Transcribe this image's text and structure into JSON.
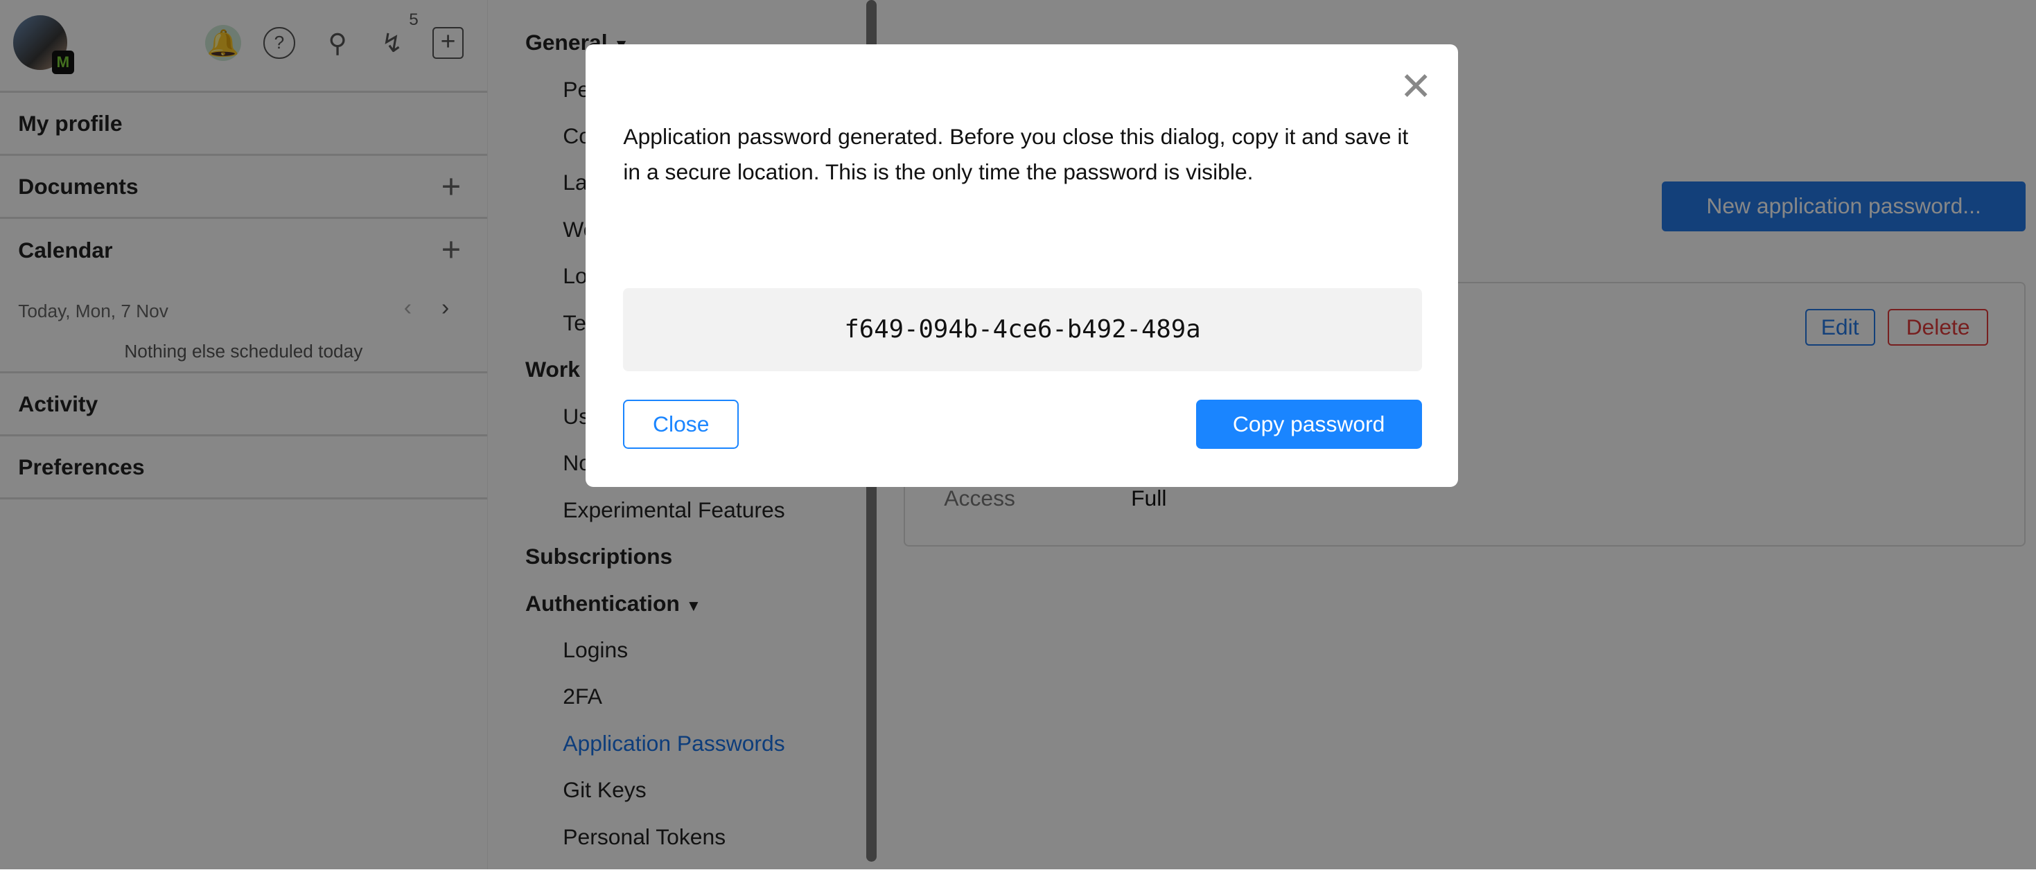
{
  "topbar": {
    "avatar_badge": "M",
    "notification_count": "5",
    "icons": [
      "bell-icon",
      "help-icon",
      "search-icon",
      "lightning-icon",
      "plus-box-icon"
    ]
  },
  "sidebar": {
    "my_profile": "My profile",
    "documents": "Documents",
    "calendar": "Calendar",
    "calendar_date": "Today, Mon, 7 Nov",
    "calendar_empty": "Nothing else scheduled today",
    "activity": "Activity",
    "preferences": "Preferences"
  },
  "settings_nav": {
    "general": "General",
    "general_items": [
      "Pe",
      "Co",
      "La",
      "We",
      "Lo",
      "Te"
    ],
    "work": "Work",
    "work_items": [
      "Us",
      "No",
      "Experimental Features"
    ],
    "subscriptions": "Subscriptions",
    "authentication": "Authentication",
    "auth_items": [
      "Logins",
      "2FA",
      "Application Passwords",
      "Git Keys",
      "Personal Tokens"
    ]
  },
  "main": {
    "new_button": "New application password...",
    "edit": "Edit",
    "delete": "Delete",
    "access_label": "Access",
    "access_value": "Full"
  },
  "dialog": {
    "message": "Application password generated. Before you close this dialog, copy it and save it in a secure location. This is the only time the password is visible.",
    "password": "f649-094b-4ce6-b492-489a",
    "close": "Close",
    "copy": "Copy password"
  },
  "colors": {
    "accent": "#1a85ff",
    "danger": "#e03b3b",
    "overlay": "rgba(0,0,0,0.47)"
  }
}
